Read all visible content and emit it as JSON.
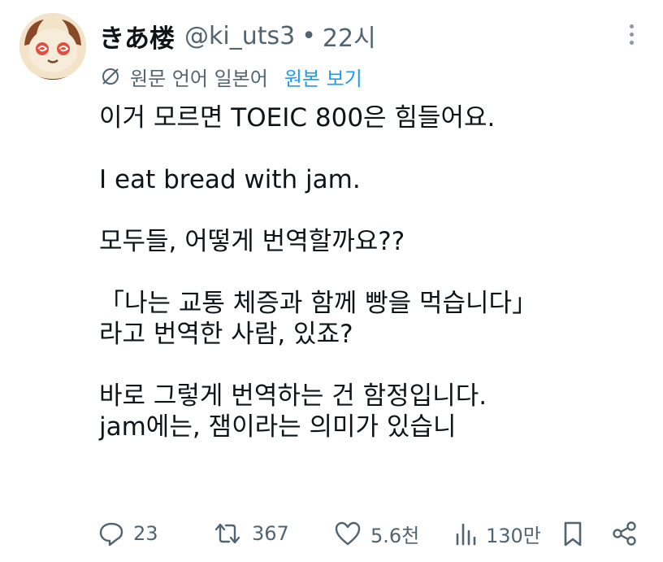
{
  "author": {
    "display_name": "きあ楼",
    "handle": "@ki_uts3",
    "separator": "•",
    "time": "22시"
  },
  "translation": {
    "note": "원문 언어 일본어",
    "view_original": "원본 보기"
  },
  "body": {
    "line_1": "이거 모르면 TOEIC 800은 힘들어요.",
    "line_2": "I eat bread with jam.",
    "line_3": "모두들, 어떻게 번역할까요??",
    "line_4": "「나는 교통 체증과 함께 빵을 먹습니다」",
    "line_5": "라고 번역한 사람, 있죠?",
    "line_6": "바로 그렇게 번역하는 건 함정입니다.",
    "line_7": "jam에는, 잼이라는 의미가 있습니"
  },
  "actions": {
    "replies": "23",
    "retweets": "367",
    "likes": "5.6천",
    "views": "130만"
  },
  "icons": {
    "more": "more-vertical-icon",
    "translate": "translate-icon",
    "reply": "reply-icon",
    "retweet": "retweet-icon",
    "like": "heart-icon",
    "views": "views-icon",
    "bookmark": "bookmark-icon",
    "share": "share-icon"
  },
  "colors": {
    "text": "#0f1419",
    "secondary": "#536471",
    "link": "#1d9bf0"
  }
}
